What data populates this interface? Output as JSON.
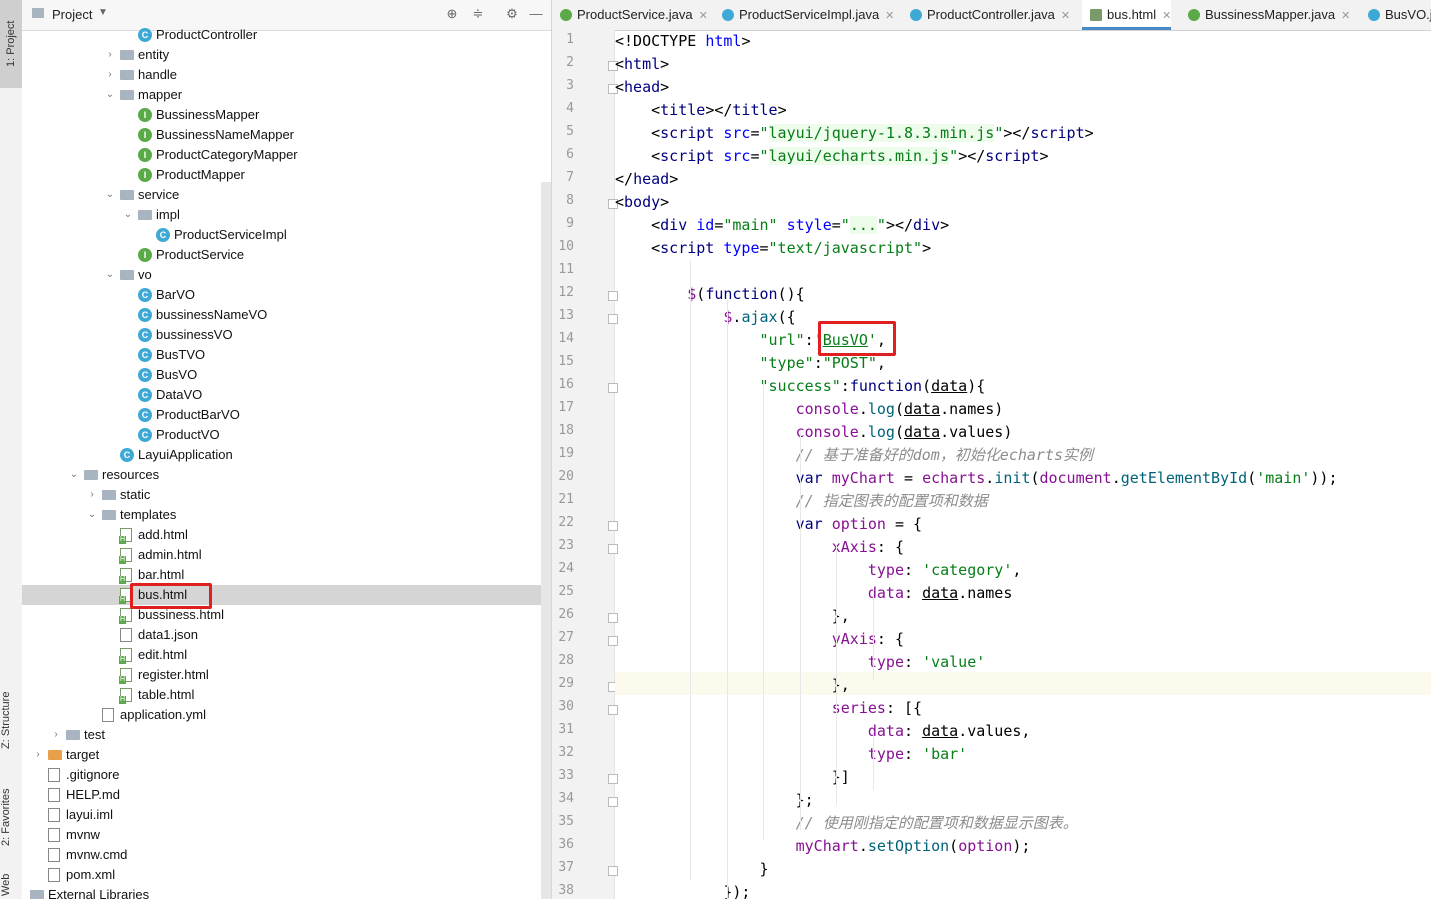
{
  "sidebar_tabs": {
    "project": "1: Project",
    "structure": "Z: Structure",
    "favorites": "2: Favorites",
    "web": "Web"
  },
  "panel": {
    "title": "Project"
  },
  "tree": [
    {
      "label": "ProductController",
      "icon": "class",
      "indent": 7,
      "chev": ""
    },
    {
      "label": "entity",
      "icon": "folder",
      "indent": 6,
      "chev": "›"
    },
    {
      "label": "handle",
      "icon": "folder",
      "indent": 6,
      "chev": "›"
    },
    {
      "label": "mapper",
      "icon": "folder",
      "indent": 6,
      "chev": "⌄"
    },
    {
      "label": "BussinessMapper",
      "icon": "iface",
      "indent": 7,
      "chev": ""
    },
    {
      "label": "BussinessNameMapper",
      "icon": "iface",
      "indent": 7,
      "chev": ""
    },
    {
      "label": "ProductCategoryMapper",
      "icon": "iface",
      "indent": 7,
      "chev": ""
    },
    {
      "label": "ProductMapper",
      "icon": "iface",
      "indent": 7,
      "chev": ""
    },
    {
      "label": "service",
      "icon": "folder",
      "indent": 6,
      "chev": "⌄"
    },
    {
      "label": "impl",
      "icon": "folder",
      "indent": 7,
      "chev": "⌄"
    },
    {
      "label": "ProductServiceImpl",
      "icon": "class",
      "indent": 8,
      "chev": ""
    },
    {
      "label": "ProductService",
      "icon": "iface",
      "indent": 7,
      "chev": ""
    },
    {
      "label": "vo",
      "icon": "folder",
      "indent": 6,
      "chev": "⌄"
    },
    {
      "label": "BarVO",
      "icon": "class",
      "indent": 7,
      "chev": ""
    },
    {
      "label": "bussinessNameVO",
      "icon": "class",
      "indent": 7,
      "chev": ""
    },
    {
      "label": "bussinessVO",
      "icon": "class",
      "indent": 7,
      "chev": ""
    },
    {
      "label": "BusTVO",
      "icon": "class",
      "indent": 7,
      "chev": ""
    },
    {
      "label": "BusVO",
      "icon": "class",
      "indent": 7,
      "chev": ""
    },
    {
      "label": "DataVO",
      "icon": "class",
      "indent": 7,
      "chev": ""
    },
    {
      "label": "ProductBarVO",
      "icon": "class",
      "indent": 7,
      "chev": ""
    },
    {
      "label": "ProductVO",
      "icon": "class",
      "indent": 7,
      "chev": ""
    },
    {
      "label": "LayuiApplication",
      "icon": "class",
      "indent": 6,
      "chev": ""
    },
    {
      "label": "resources",
      "icon": "folder",
      "indent": 4,
      "chev": "⌄"
    },
    {
      "label": "static",
      "icon": "folder",
      "indent": 5,
      "chev": "›"
    },
    {
      "label": "templates",
      "icon": "folder",
      "indent": 5,
      "chev": "⌄"
    },
    {
      "label": "add.html",
      "icon": "html",
      "indent": 6,
      "chev": ""
    },
    {
      "label": "admin.html",
      "icon": "html",
      "indent": 6,
      "chev": ""
    },
    {
      "label": "bar.html",
      "icon": "html",
      "indent": 6,
      "chev": ""
    },
    {
      "label": "bus.html",
      "icon": "html",
      "indent": 6,
      "chev": "",
      "selected": true
    },
    {
      "label": "bussiness.html",
      "icon": "html",
      "indent": 6,
      "chev": ""
    },
    {
      "label": "data1.json",
      "icon": "file",
      "indent": 6,
      "chev": ""
    },
    {
      "label": "edit.html",
      "icon": "html",
      "indent": 6,
      "chev": ""
    },
    {
      "label": "register.html",
      "icon": "html",
      "indent": 6,
      "chev": ""
    },
    {
      "label": "table.html",
      "icon": "html",
      "indent": 6,
      "chev": ""
    },
    {
      "label": "application.yml",
      "icon": "file",
      "indent": 5,
      "chev": ""
    },
    {
      "label": "test",
      "icon": "folder",
      "indent": 3,
      "chev": "›"
    },
    {
      "label": "target",
      "icon": "folder-orange",
      "indent": 2,
      "chev": "›"
    },
    {
      "label": ".gitignore",
      "icon": "file",
      "indent": 2,
      "chev": ""
    },
    {
      "label": "HELP.md",
      "icon": "file",
      "indent": 2,
      "chev": ""
    },
    {
      "label": "layui.iml",
      "icon": "file",
      "indent": 2,
      "chev": ""
    },
    {
      "label": "mvnw",
      "icon": "file",
      "indent": 2,
      "chev": ""
    },
    {
      "label": "mvnw.cmd",
      "icon": "file",
      "indent": 2,
      "chev": ""
    },
    {
      "label": "pom.xml",
      "icon": "file",
      "indent": 2,
      "chev": ""
    },
    {
      "label": "External Libraries",
      "icon": "folder",
      "indent": 1,
      "chev": "›"
    }
  ],
  "tabs": [
    {
      "label": "ProductService.java",
      "icon": "iface",
      "active": false
    },
    {
      "label": "ProductServiceImpl.java",
      "icon": "class",
      "active": false
    },
    {
      "label": "ProductController.java",
      "icon": "class",
      "active": false
    },
    {
      "label": "bus.html",
      "icon": "html",
      "active": true
    },
    {
      "label": "BussinessMapper.java",
      "icon": "iface",
      "active": false
    },
    {
      "label": "BusVO.j",
      "icon": "class",
      "active": false
    }
  ],
  "line_numbers": [
    "1",
    "2",
    "3",
    "4",
    "5",
    "6",
    "7",
    "8",
    "9",
    "10",
    "11",
    "12",
    "13",
    "14",
    "15",
    "16",
    "17",
    "18",
    "19",
    "20",
    "21",
    "22",
    "23",
    "24",
    "25",
    "26",
    "27",
    "28",
    "29",
    "30",
    "31",
    "32",
    "33",
    "34",
    "35",
    "36",
    "37",
    "38"
  ],
  "code": [
    [
      [
        "t",
        "<!DOCTYPE "
      ],
      [
        "attr",
        "html"
      ],
      [
        "t",
        ">"
      ]
    ],
    [
      [
        "t",
        "<"
      ],
      [
        "tag",
        "html"
      ],
      [
        "t",
        ">"
      ]
    ],
    [
      [
        "t",
        "<"
      ],
      [
        "tag",
        "head"
      ],
      [
        "t",
        ">"
      ]
    ],
    [
      [
        "t",
        "    <"
      ],
      [
        "tag",
        "title"
      ],
      [
        "t",
        "></"
      ],
      [
        "tag",
        "title"
      ],
      [
        "t",
        ">"
      ]
    ],
    [
      [
        "t",
        "    <"
      ],
      [
        "tag",
        "script "
      ],
      [
        "attr",
        "src"
      ],
      [
        "t",
        "="
      ],
      [
        "str",
        "\""
      ],
      [
        "strbg",
        "layui/jquery-1.8.3.min.js"
      ],
      [
        "str",
        "\""
      ],
      [
        "t",
        "></"
      ],
      [
        "tag",
        "script"
      ],
      [
        "t",
        ">"
      ]
    ],
    [
      [
        "t",
        "    <"
      ],
      [
        "tag",
        "script "
      ],
      [
        "attr",
        "src"
      ],
      [
        "t",
        "="
      ],
      [
        "str",
        "\""
      ],
      [
        "strbg",
        "layui/echarts.min.js"
      ],
      [
        "str",
        "\""
      ],
      [
        "t",
        "></"
      ],
      [
        "tag",
        "script"
      ],
      [
        "t",
        ">"
      ]
    ],
    [
      [
        "t",
        "</"
      ],
      [
        "tag",
        "head"
      ],
      [
        "t",
        ">"
      ]
    ],
    [
      [
        "t",
        "<"
      ],
      [
        "tag",
        "body"
      ],
      [
        "t",
        ">"
      ]
    ],
    [
      [
        "t",
        "    <"
      ],
      [
        "tag",
        "div "
      ],
      [
        "attr",
        "id"
      ],
      [
        "t",
        "="
      ],
      [
        "str",
        "\"main\" "
      ],
      [
        "attr",
        "style"
      ],
      [
        "t",
        "="
      ],
      [
        "str",
        "\""
      ],
      [
        "strbg",
        "..."
      ],
      [
        "str",
        "\""
      ],
      [
        "t",
        "></"
      ],
      [
        "tag",
        "div"
      ],
      [
        "t",
        ">"
      ]
    ],
    [
      [
        "t",
        "    <"
      ],
      [
        "tag",
        "script "
      ],
      [
        "attr",
        "type"
      ],
      [
        "t",
        "="
      ],
      [
        "str",
        "\"text/javascript\""
      ],
      [
        "t",
        ">"
      ]
    ],
    [
      [
        "t",
        ""
      ]
    ],
    [
      [
        "t",
        "        "
      ],
      [
        "var",
        "$"
      ],
      [
        "t",
        "("
      ],
      [
        "kw",
        "function"
      ],
      [
        "t",
        "(){"
      ]
    ],
    [
      [
        "t",
        "            "
      ],
      [
        "var",
        "$"
      ],
      [
        "t",
        "."
      ],
      [
        "fn",
        "ajax"
      ],
      [
        "t",
        "({"
      ]
    ],
    [
      [
        "t",
        "                "
      ],
      [
        "str",
        "\"url\""
      ],
      [
        "t",
        ":"
      ],
      [
        "str",
        "'"
      ],
      [
        "str ul",
        "BusVO"
      ],
      [
        "str",
        "'"
      ],
      [
        "t",
        ","
      ]
    ],
    [
      [
        "t",
        "                "
      ],
      [
        "str",
        "\"type\""
      ],
      [
        "t",
        ":"
      ],
      [
        "str",
        "\"POST\""
      ],
      [
        "t",
        ","
      ]
    ],
    [
      [
        "t",
        "                "
      ],
      [
        "str",
        "\"success\""
      ],
      [
        "t",
        ":"
      ],
      [
        "kw",
        "function"
      ],
      [
        "t",
        "("
      ],
      [
        "ul",
        "data"
      ],
      [
        "t",
        "){"
      ]
    ],
    [
      [
        "t",
        "                    "
      ],
      [
        "var",
        "console"
      ],
      [
        "t",
        "."
      ],
      [
        "fn",
        "log"
      ],
      [
        "t",
        "("
      ],
      [
        "ul",
        "data"
      ],
      [
        "t",
        ".names)"
      ]
    ],
    [
      [
        "t",
        "                    "
      ],
      [
        "var",
        "console"
      ],
      [
        "t",
        "."
      ],
      [
        "fn",
        "log"
      ],
      [
        "t",
        "("
      ],
      [
        "ul",
        "data"
      ],
      [
        "t",
        ".values)"
      ]
    ],
    [
      [
        "t",
        "                    "
      ],
      [
        "cm",
        "// 基于准备好的dom，初始化echarts实例"
      ]
    ],
    [
      [
        "t",
        "                    "
      ],
      [
        "kw",
        "var "
      ],
      [
        "var",
        "myChart"
      ],
      [
        "t",
        " = "
      ],
      [
        "var",
        "echarts"
      ],
      [
        "t",
        "."
      ],
      [
        "fn",
        "init"
      ],
      [
        "t",
        "("
      ],
      [
        "var",
        "document"
      ],
      [
        "t",
        "."
      ],
      [
        "fn",
        "getElementById"
      ],
      [
        "t",
        "("
      ],
      [
        "str",
        "'main'"
      ],
      [
        "t",
        "));"
      ]
    ],
    [
      [
        "t",
        "                    "
      ],
      [
        "cm",
        "// 指定图表的配置项和数据"
      ]
    ],
    [
      [
        "t",
        "                    "
      ],
      [
        "kw",
        "var "
      ],
      [
        "var",
        "option"
      ],
      [
        "t",
        " = {"
      ]
    ],
    [
      [
        "t",
        "                        "
      ],
      [
        "var",
        "xAxis"
      ],
      [
        "t",
        ": {"
      ]
    ],
    [
      [
        "t",
        "                            "
      ],
      [
        "var",
        "type"
      ],
      [
        "t",
        ": "
      ],
      [
        "str",
        "'category'"
      ],
      [
        "t",
        ","
      ]
    ],
    [
      [
        "t",
        "                            "
      ],
      [
        "var",
        "data"
      ],
      [
        "t",
        ": "
      ],
      [
        "ul",
        "data"
      ],
      [
        "t",
        ".names"
      ]
    ],
    [
      [
        "t",
        "                        },"
      ]
    ],
    [
      [
        "t",
        "                        "
      ],
      [
        "var",
        "yAxis"
      ],
      [
        "t",
        ": {"
      ]
    ],
    [
      [
        "t",
        "                            "
      ],
      [
        "var",
        "type"
      ],
      [
        "t",
        ": "
      ],
      [
        "str",
        "'value'"
      ]
    ],
    [
      [
        "t",
        "                        },"
      ]
    ],
    [
      [
        "t",
        "                        "
      ],
      [
        "var",
        "series"
      ],
      [
        "t",
        ": [{"
      ]
    ],
    [
      [
        "t",
        "                            "
      ],
      [
        "var",
        "data"
      ],
      [
        "t",
        ": "
      ],
      [
        "ul",
        "data"
      ],
      [
        "t",
        ".values,"
      ]
    ],
    [
      [
        "t",
        "                            "
      ],
      [
        "var",
        "type"
      ],
      [
        "t",
        ": "
      ],
      [
        "str",
        "'bar'"
      ]
    ],
    [
      [
        "t",
        "                        }]"
      ]
    ],
    [
      [
        "t",
        "                    };"
      ]
    ],
    [
      [
        "t",
        "                    "
      ],
      [
        "cm",
        "// 使用刚指定的配置项和数据显示图表。"
      ]
    ],
    [
      [
        "t",
        "                    "
      ],
      [
        "var",
        "myChart"
      ],
      [
        "t",
        "."
      ],
      [
        "fn",
        "setOption"
      ],
      [
        "t",
        "("
      ],
      [
        "var",
        "option"
      ],
      [
        "t",
        ");"
      ]
    ],
    [
      [
        "t",
        "                }"
      ]
    ],
    [
      [
        "t",
        "            });"
      ]
    ]
  ],
  "colors": {
    "accent": "#4a88c7",
    "highlight_box": "#e02020",
    "string": "#067d17",
    "keyword": "#000080"
  }
}
